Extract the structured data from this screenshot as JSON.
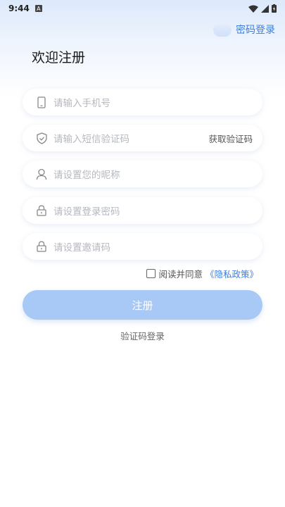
{
  "status_bar": {
    "time": "9:44",
    "notif_icon": "A"
  },
  "header": {
    "password_login_link": "密码登录",
    "title": "欢迎注册"
  },
  "form": {
    "phone_placeholder": "请输入手机号",
    "sms_code_placeholder": "请输入短信验证码",
    "get_code_label": "获取验证码",
    "nickname_placeholder": "请设置您的昵称",
    "password_placeholder": "请设置登录密码",
    "invite_code_placeholder": "请设置邀请码"
  },
  "agreement": {
    "text": "阅读并同意",
    "policy_link": "《隐私政策》"
  },
  "actions": {
    "register_label": "注册",
    "code_login_label": "验证码登录"
  },
  "colors": {
    "accent": "#3d7fe0",
    "button": "#a8c8f5",
    "placeholder": "#b5b8bf"
  }
}
